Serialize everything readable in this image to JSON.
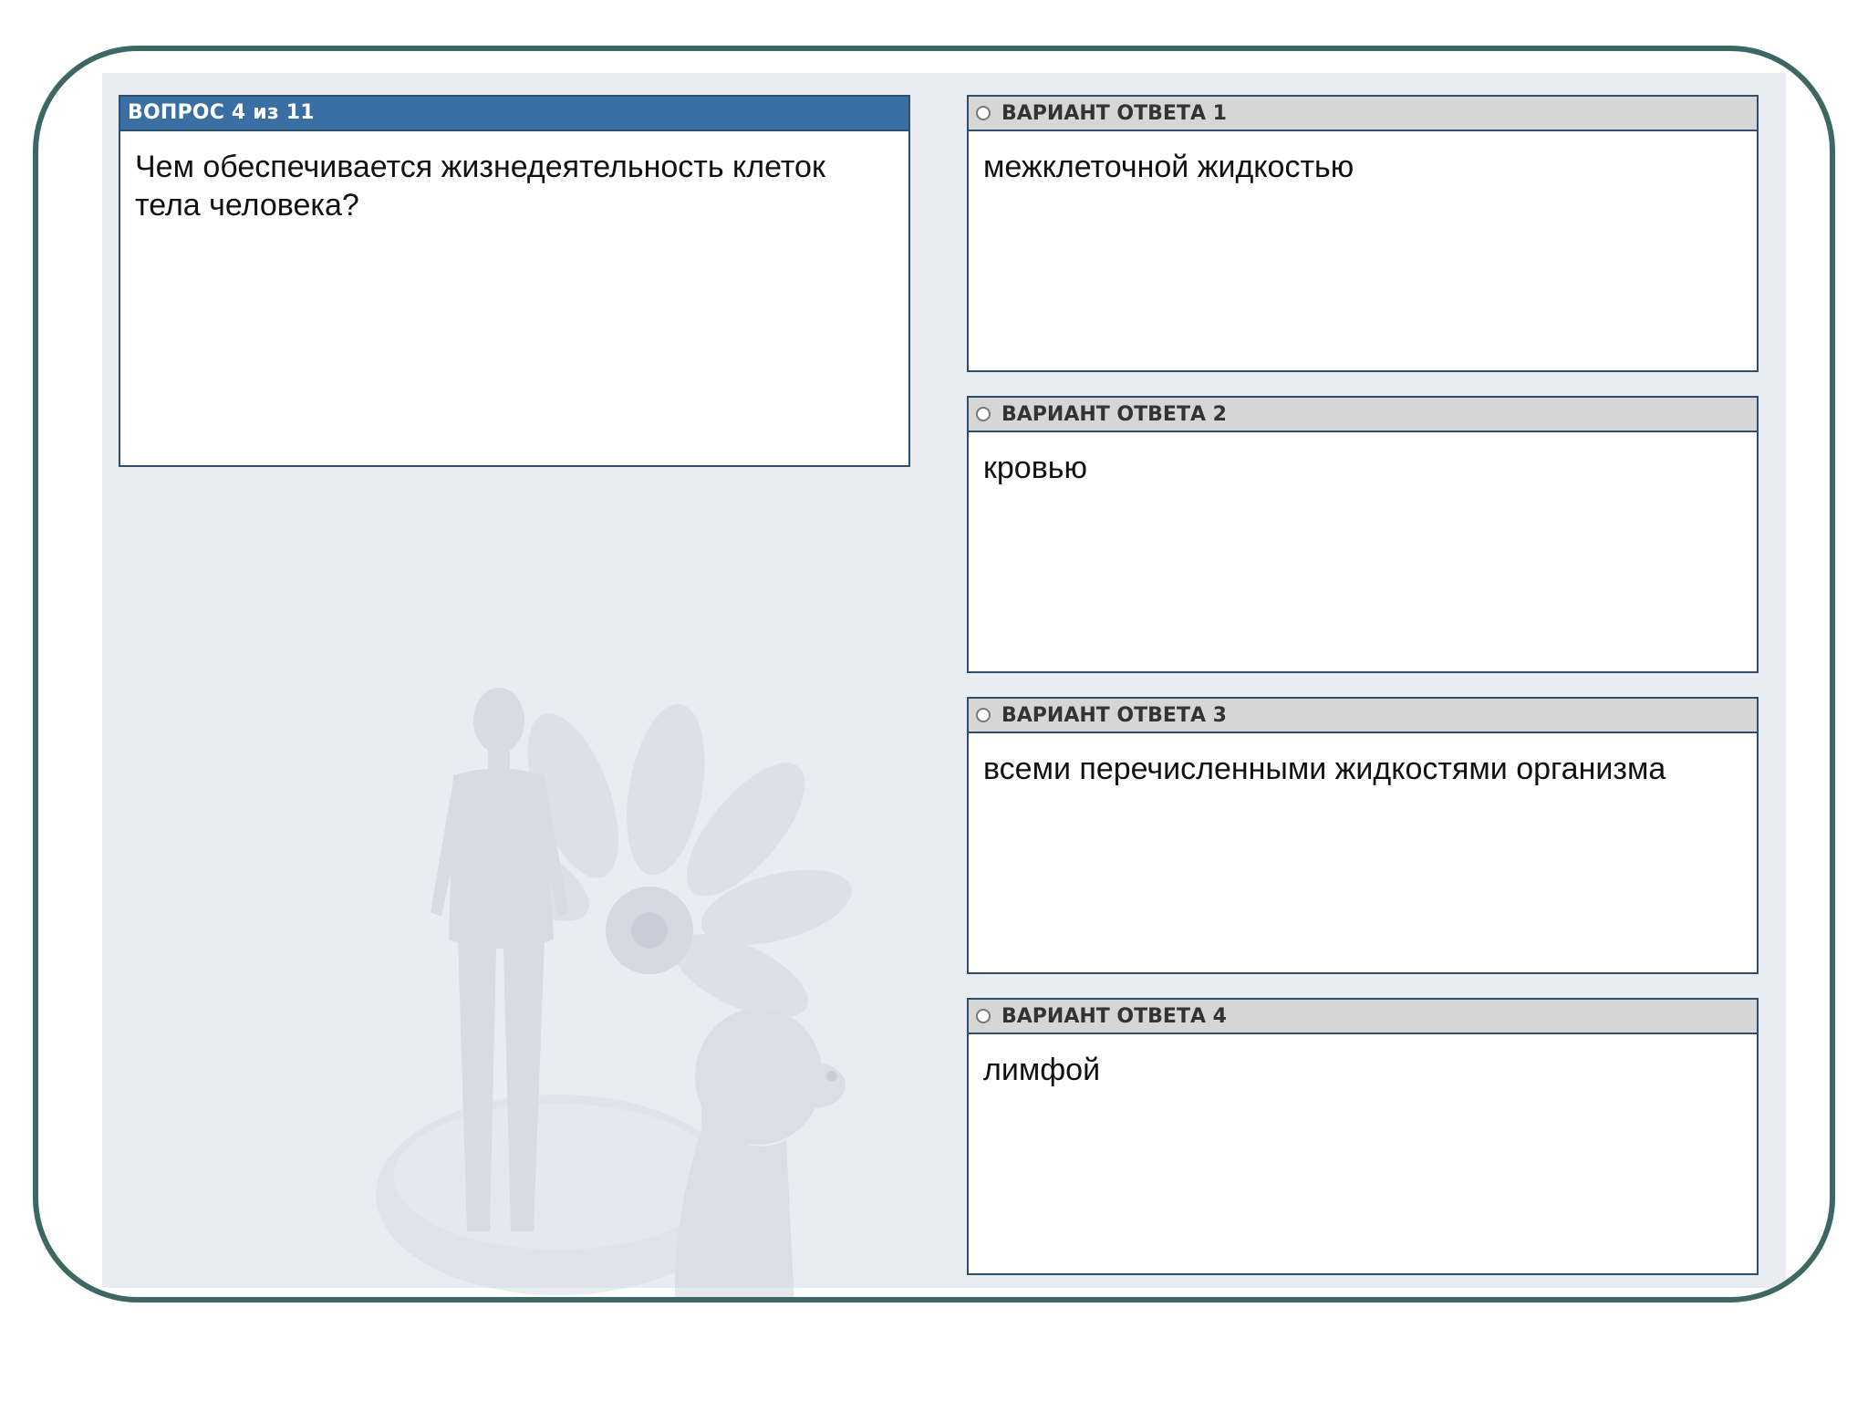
{
  "question": {
    "header": "ВОПРОС 4 из 11",
    "text": "Чем обеспечивается жизнедеятельность клеток тела человека?"
  },
  "answers": [
    {
      "label": "ВАРИАНТ ОТВЕТА 1",
      "text": "межклеточной жидкостью"
    },
    {
      "label": "ВАРИАНТ ОТВЕТА 2",
      "text": "кровью"
    },
    {
      "label": "ВАРИАНТ ОТВЕТА 3",
      "text": "всеми перечисленными жидкостями организма"
    },
    {
      "label": "ВАРИАНТ ОТВЕТА 4",
      "text": "лимфой"
    }
  ],
  "colors": {
    "frame_border": "#3d6763",
    "panel_background": "#e9ecf3",
    "question_header": "#3a6fa3",
    "answer_header": "#d6d6d6",
    "box_border": "#2f4e6b"
  },
  "illustration": {
    "icon": "human-figure-flower-dog-illustration"
  }
}
